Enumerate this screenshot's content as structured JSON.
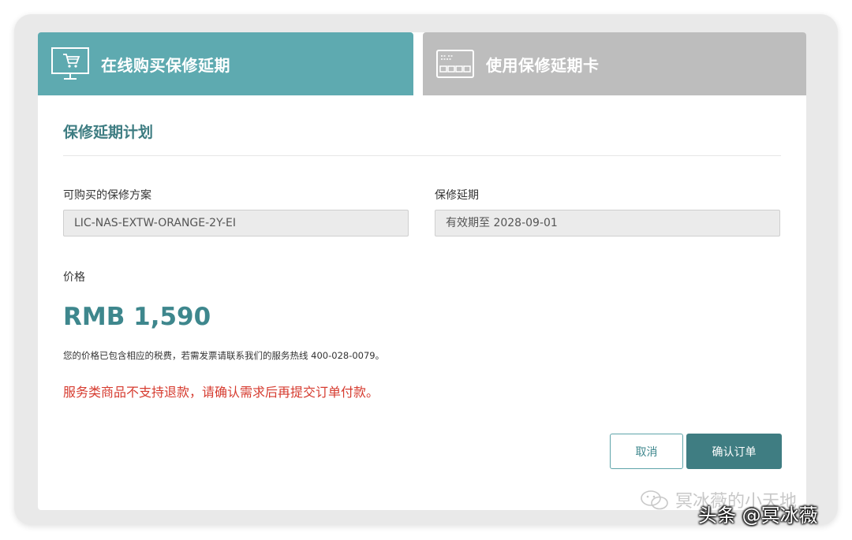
{
  "tabs": {
    "online": {
      "label": "在线购买保修延期",
      "icon": "cart-monitor-icon",
      "active": true,
      "color": "#5eaab0"
    },
    "card": {
      "label": "使用保修延期卡",
      "icon": "card-icon",
      "active": false,
      "color": "#bdbdbd"
    }
  },
  "section": {
    "title": "保修延期计划"
  },
  "fields": {
    "plan": {
      "label": "可购买的保修方案",
      "value": "LIC-NAS-EXTW-ORANGE-2Y-EI"
    },
    "period": {
      "label": "保修延期",
      "value": "有效期至 2028-09-01"
    }
  },
  "price": {
    "label": "价格",
    "amount": "RMB 1,590",
    "note": "您的价格已包含相应的税费，若需发票请联系我们的服务热线 400-028-0079。",
    "warning": "服务类商品不支持退款，请确认需求后再提交订单付款。"
  },
  "buttons": {
    "cancel": "取消",
    "confirm": "确认订单"
  },
  "watermarks": {
    "wechat": "冥冰薇的小天地",
    "toutiao": "头条 @冥冰薇"
  },
  "colors": {
    "accent": "#3e878d",
    "warning": "#d63b2f"
  }
}
